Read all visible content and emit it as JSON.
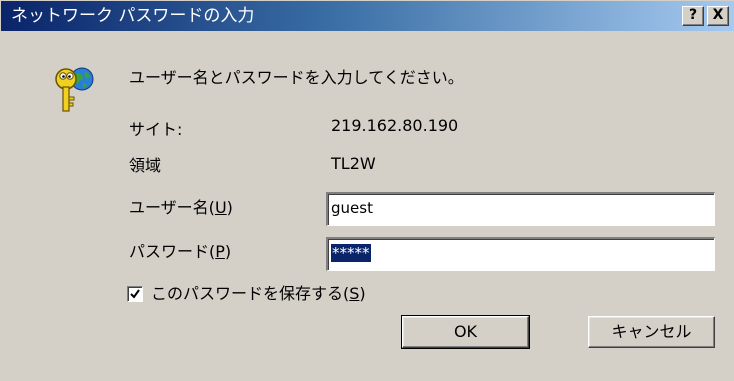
{
  "window": {
    "title": "ネットワーク パスワードの入力",
    "help_button": "?",
    "close_button": "X"
  },
  "dialog": {
    "prompt": "ユーザー名とパスワードを入力してください。",
    "site_label": "サイト:",
    "site_value": "219.162.80.190",
    "realm_label": "領域",
    "realm_value": "TL2W",
    "username_label_prefix": "ユーザー名(",
    "username_label_key": "U",
    "username_label_suffix": ")",
    "username_value": "guest",
    "password_label_prefix": "パスワード(",
    "password_label_key": "P",
    "password_label_suffix": ")",
    "password_value": "*****",
    "save_password_label_prefix": "このパスワードを保存する(",
    "save_password_label_key": "S",
    "save_password_label_suffix": ")",
    "save_password_checked": true,
    "ok_label": "OK",
    "cancel_label": "キャンセル"
  },
  "icons": {
    "key_icon": "key-globe-icon",
    "check_icon": "checkmark-icon"
  },
  "colors": {
    "title_gradient_start": "#0a246a",
    "title_gradient_end": "#a6caf0",
    "dialog_background": "#d4d0c8",
    "selection": "#0a246a"
  }
}
